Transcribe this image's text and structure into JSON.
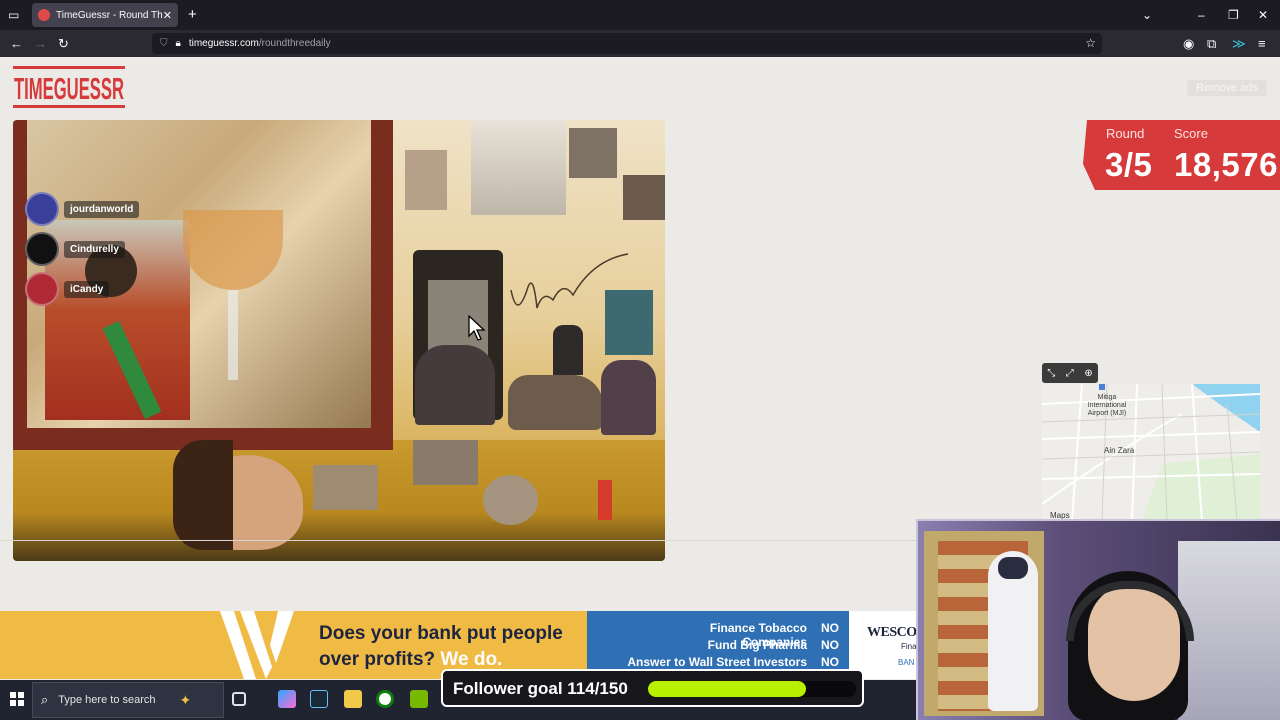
{
  "browser": {
    "tab_title": "TimeGuessr - Round Three",
    "url_host": "timeguessr.com",
    "url_path": "/roundthreedaily",
    "new_tab_icon": "plus-icon",
    "close_tab_icon": "close-icon"
  },
  "site": {
    "logo_text": "TIMEGUESSR",
    "remove_ads_label": "Remove ads",
    "accent_color": "#d63a3a"
  },
  "score": {
    "round_label": "Round",
    "score_label": "Score",
    "round_value": "3/5",
    "score_value": "18,576"
  },
  "players": [
    {
      "name": "jourdanworld",
      "color": "#3a3f9a"
    },
    {
      "name": "Cindurelly",
      "color": "#111111"
    },
    {
      "name": "iCandy",
      "color": "#b02a35"
    }
  ],
  "map": {
    "label_airport": "Mitiga International Airport (MJI)",
    "label_district": "Ain Zara",
    "attribution": "Maps"
  },
  "ad": {
    "headline_line1": "Does your bank put people",
    "headline_line2_a": "over profits?",
    "headline_line2_b": "We do.",
    "rows": [
      {
        "q": "Finance Tobacco Companies",
        "a": "NO"
      },
      {
        "q": "Fund Big Pharma",
        "a": "NO"
      },
      {
        "q": "Answer to Wall Street Investors",
        "a": "NO"
      }
    ],
    "brand": "WESCO",
    "brand_sub": "Fina",
    "brand_sub2": "BAN"
  },
  "taskbar": {
    "search_placeholder": "Type here to search"
  },
  "follower_goal": {
    "text": "Follower goal 114/150",
    "current": 114,
    "target": 150
  }
}
